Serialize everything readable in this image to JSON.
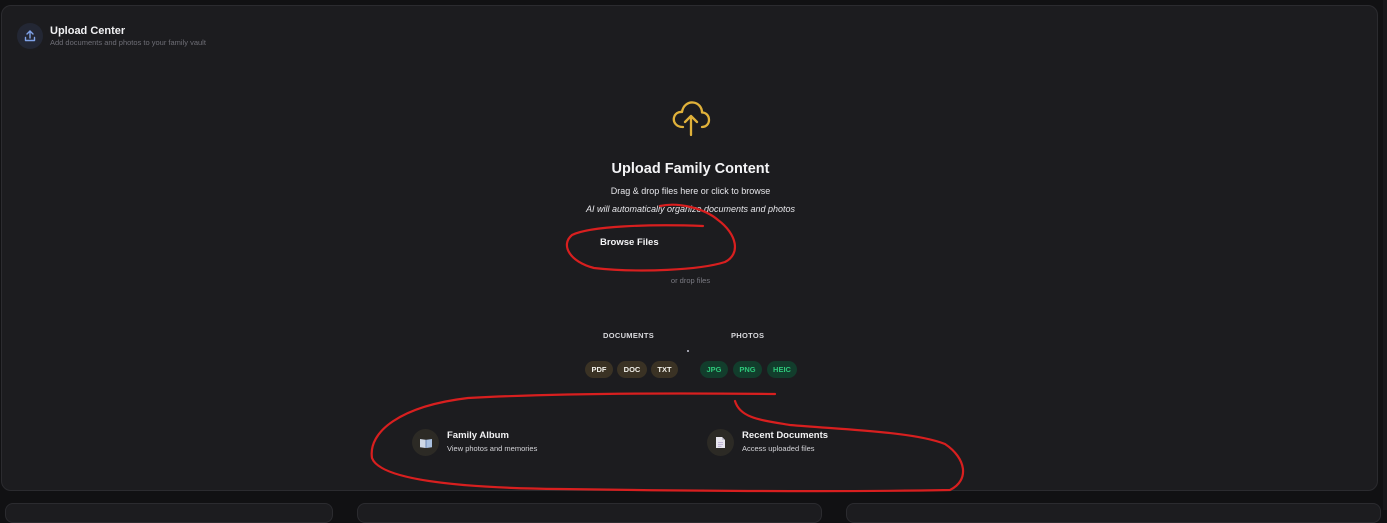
{
  "header": {
    "icon": "upload-icon",
    "title": "Upload Center",
    "subtitle": "Add documents and photos to your family vault"
  },
  "dropzone": {
    "icon": "cloud-upload-icon",
    "title": "Upload Family Content",
    "instruction": "Drag & drop files here or click to browse",
    "ai_note": "AI will automatically organize documents and photos",
    "browse_label": "Browse Files",
    "or_drop": "or drop files"
  },
  "formats": {
    "documents_label": "DOCUMENTS",
    "photos_label": "PHOTOS",
    "documents": [
      "PDF",
      "DOC",
      "TXT"
    ],
    "photos": [
      "JPG",
      "PNG",
      "HEIC"
    ]
  },
  "shortcuts": [
    {
      "icon": "book-icon",
      "title": "Family Album",
      "subtitle": "View photos and memories"
    },
    {
      "icon": "document-icon",
      "title": "Recent Documents",
      "subtitle": "Access uploaded files"
    }
  ],
  "colors": {
    "accent_gold": "#e0b13a",
    "photo_green": "#2ec77a",
    "annotation_red": "#d81f1f"
  }
}
